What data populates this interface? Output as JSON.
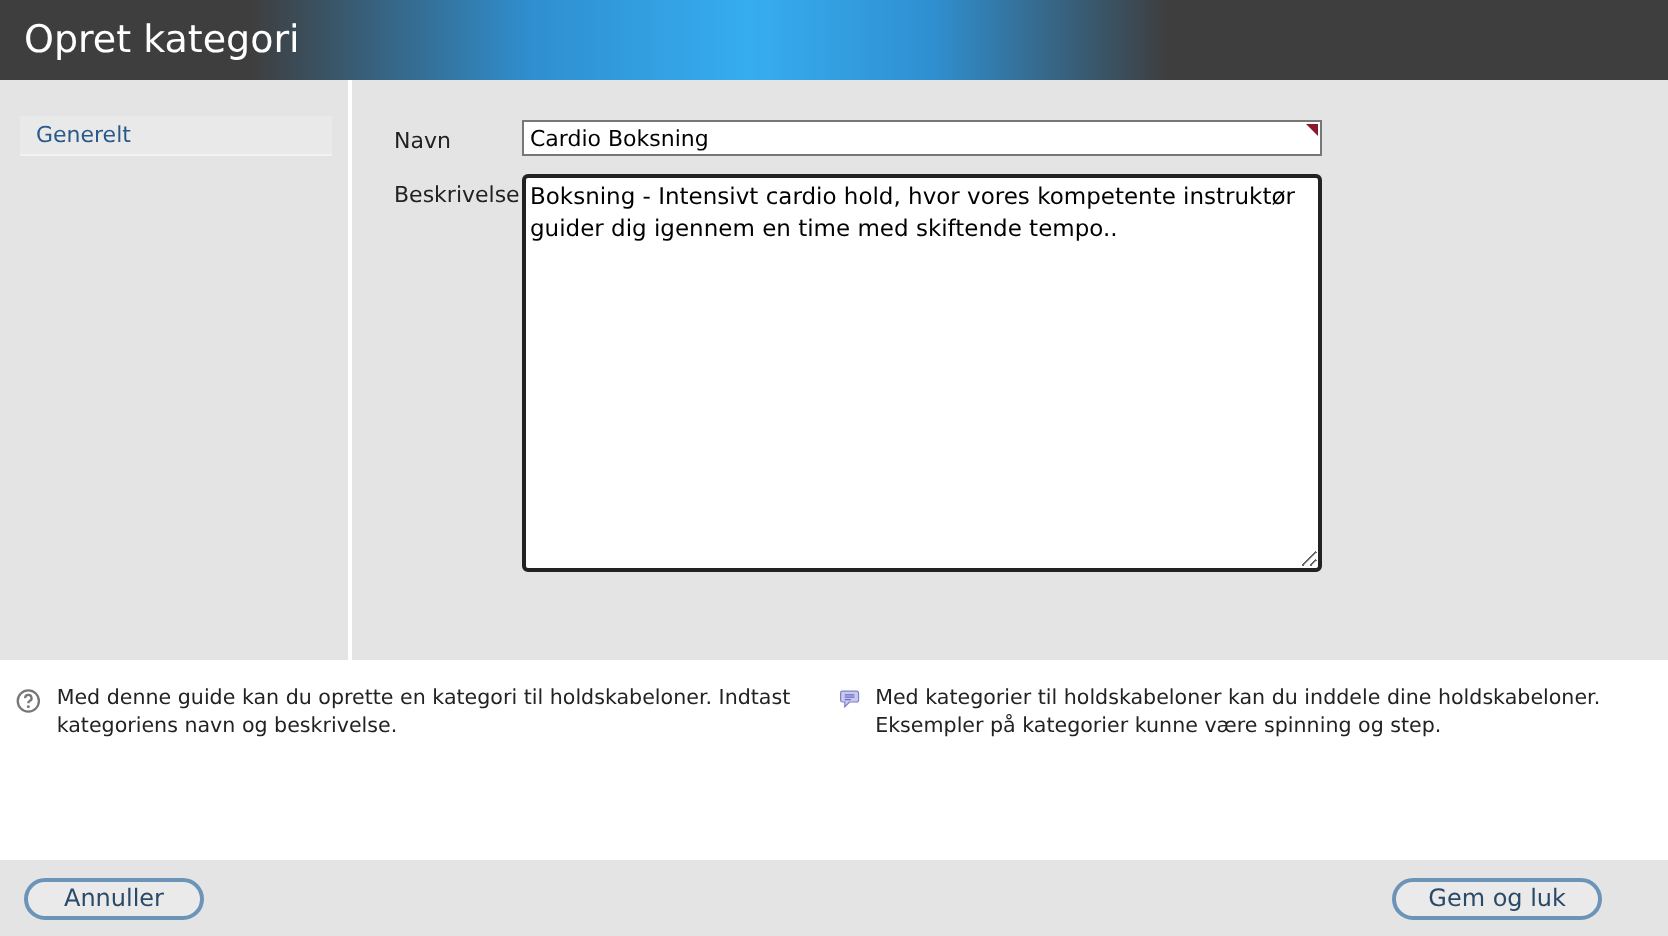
{
  "window": {
    "title": "Opret kategori"
  },
  "sidebar": {
    "items": [
      {
        "label": "Generelt",
        "selected": true
      }
    ]
  },
  "form": {
    "fields": [
      {
        "kind": "input",
        "label": "Navn",
        "value": "Cardio Boksning",
        "required": true
      },
      {
        "kind": "textarea",
        "label": "Beskrivelse",
        "value": "Boksning - Intensivt cardio hold, hvor vores kompetente instruktør guider dig igennem en time med skiftende tempo.."
      }
    ]
  },
  "info": [
    {
      "kind": "help",
      "text": "Med denne guide kan du oprette en kategori til holdskabeloner. Indtast kategoriens navn og beskrivelse."
    },
    {
      "kind": "tip",
      "text": "Med kategorier til holdskabeloner kan du inddele dine holdskabeloner. Eksempler på kategorier kunne være spinning og step."
    }
  ],
  "buttons": [
    {
      "label": "Annuller"
    },
    {
      "label": "Gem og luk"
    }
  ]
}
